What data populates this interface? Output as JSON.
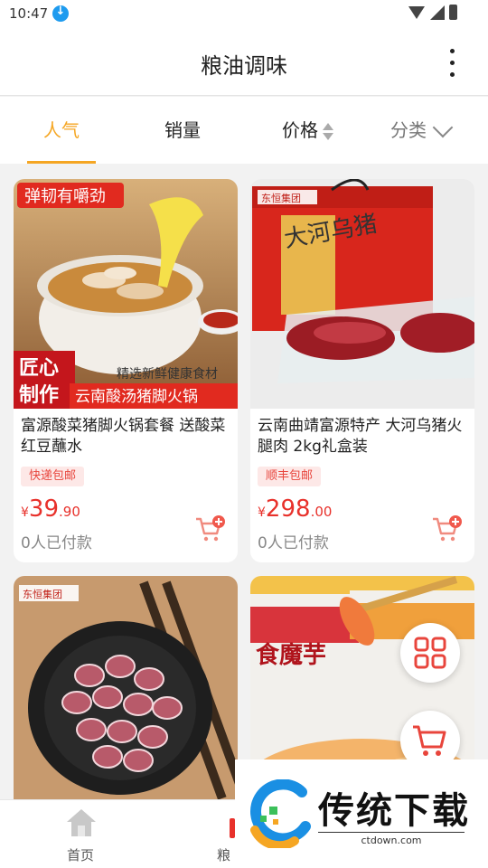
{
  "status_bar": {
    "time": "10:47"
  },
  "header": {
    "title": "粮油调味"
  },
  "tabs": [
    {
      "label": "人气"
    },
    {
      "label": "销量"
    },
    {
      "label": "价格"
    },
    {
      "label": "分类"
    }
  ],
  "products": [
    {
      "title": "富源酸菜猪脚火锅套餐 送酸菜红豆蘸水",
      "tag": "快递包邮",
      "price_symbol": "¥",
      "price_int": "39",
      "price_dec": ".90",
      "sold": "0人已付款",
      "image_text": {
        "top": "弹韧有嚼劲",
        "mid": "精选新鲜健康食材",
        "badge_1": "匠心",
        "badge_2": "制作",
        "bottom": "云南酸汤猪脚火锅"
      }
    },
    {
      "title": "云南曲靖富源特产 大河乌猪火腿肉 2kg礼盒装",
      "tag": "顺丰包邮",
      "price_symbol": "¥",
      "price_int": "298",
      "price_dec": ".00",
      "sold": "0人已付款",
      "image_text": {
        "brand": "东恒集团",
        "box": "大河乌猪"
      }
    },
    {
      "image_text": {
        "brand": "东恒集团"
      }
    },
    {
      "image_text": {
        "pack": "食魔芋"
      }
    }
  ],
  "bottom_nav": [
    {
      "label": "首页"
    },
    {
      "label": "粮"
    }
  ],
  "watermark": {
    "text": "传统下载",
    "url": "ctdown.com"
  },
  "colors": {
    "accent": "#f5a623",
    "price": "#e8312b",
    "tag_bg": "#fde8e7"
  },
  "icons": [
    "download-icon",
    "wifi-icon",
    "signal-icon",
    "battery-icon",
    "more-icon",
    "sort-icon",
    "chevron-down-icon",
    "cart-add-icon",
    "grid-icon",
    "cart-icon",
    "home-icon"
  ]
}
